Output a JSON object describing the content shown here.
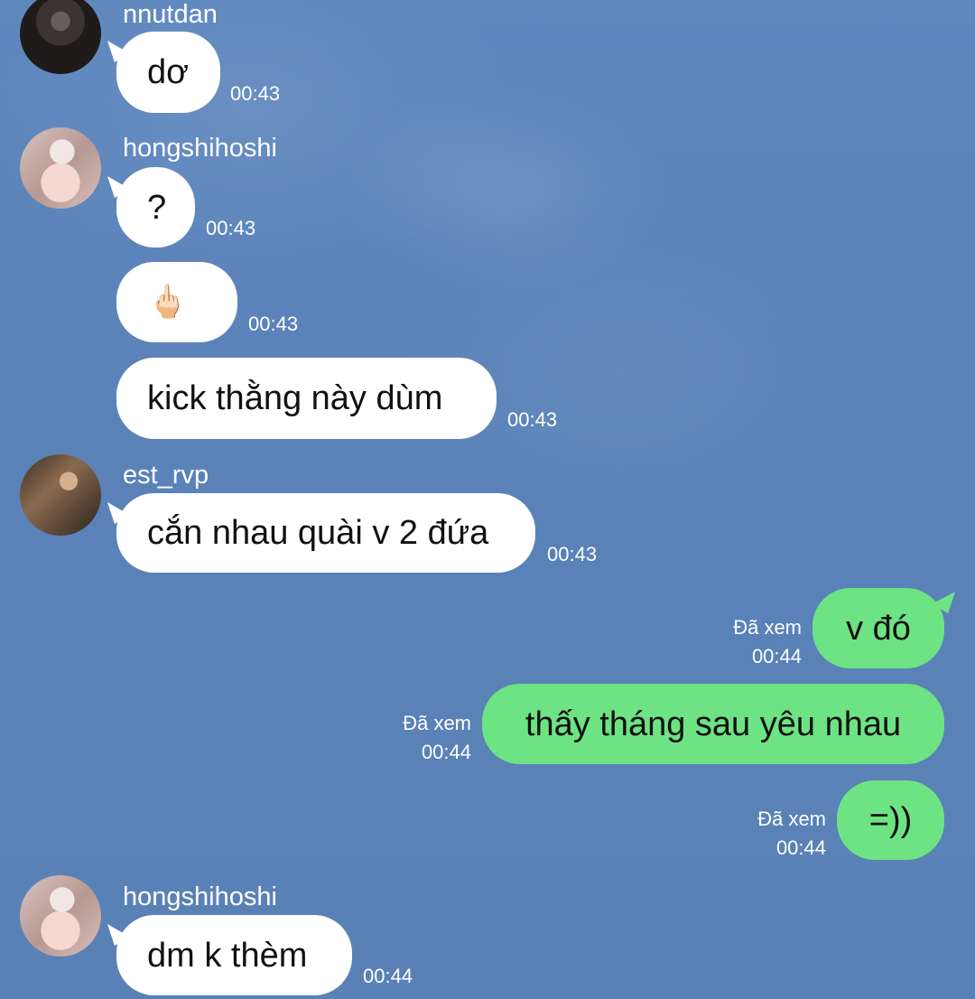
{
  "conversation": {
    "messages": [
      {
        "sender": "nnutdan",
        "text": "dơ",
        "time": "00:43"
      },
      {
        "sender": "hongshihoshi",
        "text": "?",
        "time": "00:43"
      },
      {
        "emoji": "🖕🏻",
        "time": "00:43"
      },
      {
        "text": "kick thằng này dùm",
        "time": "00:43"
      },
      {
        "sender": "est_rvp",
        "text": "cắn nhau quài v 2 đứa",
        "time": "00:43"
      },
      {
        "text": "v đó",
        "status": "Đã xem",
        "time": "00:44"
      },
      {
        "text": "thấy tháng sau yêu nhau",
        "status": "Đã xem",
        "time": "00:44"
      },
      {
        "text": "=))",
        "status": "Đã xem",
        "time": "00:44"
      },
      {
        "sender": "hongshihoshi",
        "text": "dm k thèm",
        "time": "00:44"
      }
    ]
  }
}
